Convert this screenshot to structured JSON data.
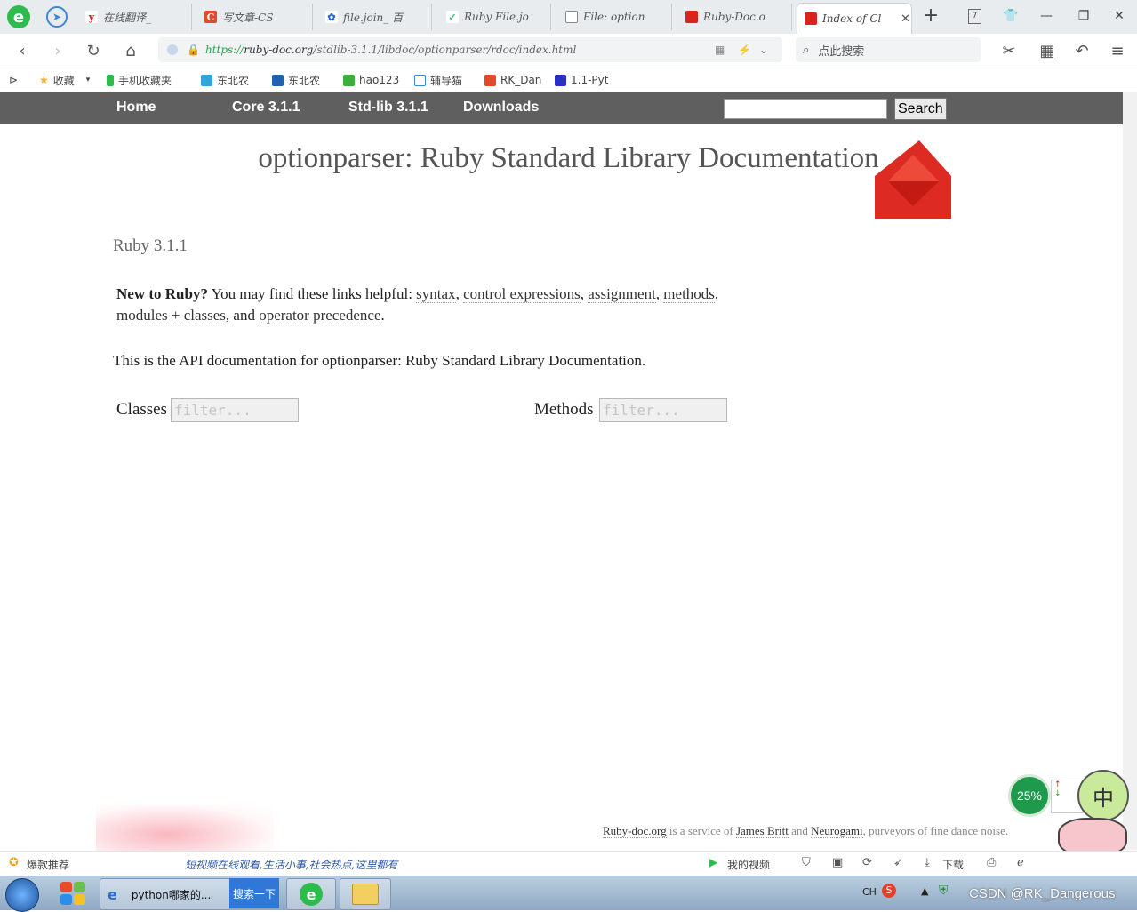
{
  "browser": {
    "tabs": [
      {
        "label": "在线翻译_",
        "icon": "youdao-icon"
      },
      {
        "label": "写文章-CS",
        "icon": "csdn-icon"
      },
      {
        "label": "file.join_ 百",
        "icon": "baidu-icon"
      },
      {
        "label": "Ruby File.jo",
        "icon": "vue-icon"
      },
      {
        "label": "File: option",
        "icon": "page-icon"
      },
      {
        "label": "Ruby-Doc.o",
        "icon": "ruby-icon"
      },
      {
        "label": "Index of Cl",
        "icon": "ruby-icon"
      }
    ],
    "new_tab": "+",
    "counter": "7",
    "url": {
      "scheme": "https://",
      "host": "ruby-doc.org",
      "path": "/stdlib-3.1.1/libdoc/optionparser/rdoc/index.html"
    },
    "search_placeholder": "点此搜索",
    "bookmarks": [
      {
        "label": "收藏"
      },
      {
        "label": "手机收藏夹"
      },
      {
        "label": "东北农"
      },
      {
        "label": "东北农"
      },
      {
        "label": "hao123"
      },
      {
        "label": "辅导猫"
      },
      {
        "label": "RK_Dan"
      },
      {
        "label": "1.1-Pyt"
      }
    ]
  },
  "site_nav": {
    "home": "Home",
    "core": "Core 3.1.1",
    "stdlib": "Std-lib 3.1.1",
    "downloads": "Downloads",
    "search_button": "Search"
  },
  "page": {
    "title": "optionparser: Ruby Standard Library Documentation",
    "version": "Ruby 3.1.1",
    "new_to_ruby_bold": "New to Ruby?",
    "new_to_ruby_text": " You may find these links helpful: ",
    "links": {
      "syntax": "syntax",
      "control": "control expressions",
      "assignment": "assignment",
      "methods": "methods",
      "modules": "modules + classes",
      "operator": "operator precedence"
    },
    "comma": ",",
    "and_text": ", and ",
    "period": ".",
    "api_text": "This is the API documentation for optionparser: Ruby Standard Library Documentation.",
    "classes_label": "Classes",
    "methods_label": "Methods",
    "filter_placeholder": "filter..."
  },
  "footer": {
    "site": "Ruby-doc.org",
    "is_service": " is a service of ",
    "james": "James Britt",
    "and": " and ",
    "neurogami": "Neurogami",
    "tail": ", purveyors of fine dance noise."
  },
  "statusbar": {
    "recommend": "爆款推荐",
    "ticker": "短视频在线观看,生活小事,社会热点,这里都有",
    "my_video": "我的视频",
    "download": "下载",
    "net_percent": "25%",
    "ime": "中"
  },
  "taskbar": {
    "window_label": "python哪家的...",
    "search_btn": "搜索一下",
    "lang": "CH",
    "watermark": "CSDN @RK_Dangerous"
  }
}
